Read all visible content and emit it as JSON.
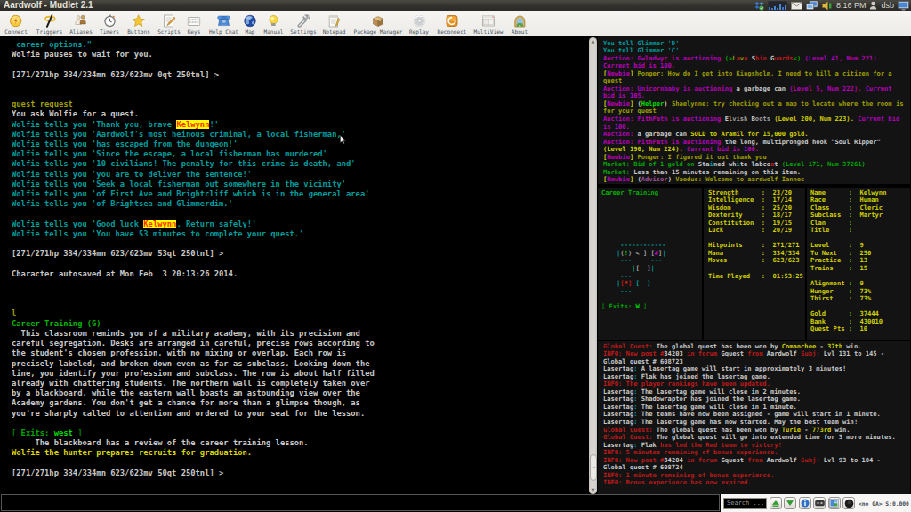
{
  "window": {
    "title": "Aardwolf - Mudlet 2.1"
  },
  "tray": {
    "time": "8:16 PM",
    "user": "dsb",
    "icons": [
      "dropbox",
      "system-monitor",
      "mail",
      "network",
      "volume",
      "user",
      "display"
    ]
  },
  "toolbar": {
    "items": [
      {
        "id": "connect",
        "label": "Connect"
      },
      {
        "id": "triggers",
        "label": "Triggers"
      },
      {
        "id": "aliases",
        "label": "Aliases"
      },
      {
        "id": "timers",
        "label": "Timers"
      },
      {
        "id": "buttons",
        "label": "Buttons"
      },
      {
        "id": "scripts",
        "label": "Scripts"
      },
      {
        "id": "keys",
        "label": "Keys"
      },
      {
        "id": "helpchat",
        "label": "Help Chat"
      },
      {
        "id": "map",
        "label": "Map"
      },
      {
        "id": "manual",
        "label": "Manual"
      },
      {
        "id": "settings",
        "label": "Settings"
      },
      {
        "id": "notepad",
        "label": "Notepad"
      },
      {
        "id": "package",
        "label": "Package Manager"
      },
      {
        "id": "replay",
        "label": "Replay"
      },
      {
        "id": "reconnect",
        "label": "Reconnect"
      },
      {
        "id": "multiview",
        "label": "MultiView"
      },
      {
        "id": "about",
        "label": "About"
      }
    ]
  },
  "palette": {
    "w": "#c8c8c8",
    "c": "#009c9c",
    "o": "#9e9e00",
    "y": "#cfcf00",
    "Y": "#d8d800",
    "m": "#b800b8",
    "M": "#d400d4",
    "dm": "#9c4f9c",
    "r": "#bb1a1a",
    "R": "#e82222",
    "g": "#00a400",
    "G": "#00dc00",
    "dg": "#008000",
    "GT": "#00b400",
    "gr": "#9f9f9f",
    "hl": "#ff3000 on #ffff00"
  },
  "main_console": {
    "lines": [
      [
        [
          "c",
          " career options.\""
        ]
      ],
      "Wolfie pauses to wait for you.",
      "",
      "[271/271hp 334/334mn 623/623mv 0qt 250tnl] >",
      "",
      "",
      [
        [
          "o",
          "quest request"
        ]
      ],
      "You ask Wolfie for a quest.",
      [
        [
          "c",
          "Wolfie tells you 'Thank you, brave "
        ],
        [
          "hl",
          "Kelwynn"
        ],
        [
          "c",
          "!'"
        ]
      ],
      [
        [
          "c",
          "Wolfie tells you 'Aardwolf's most heinous criminal, a local fisherman,'"
        ]
      ],
      [
        [
          "c",
          "Wolfie tells you 'has escaped from the dungeon!'"
        ]
      ],
      [
        [
          "c",
          "Wolfie tells you 'Since the escape, a local fisherman has murdered'"
        ]
      ],
      [
        [
          "c",
          "Wolfie tells you '10 civilians! The penalty for this crime is death, and'"
        ]
      ],
      [
        [
          "c",
          "Wolfie tells you 'you are to deliver the sentence!'"
        ]
      ],
      [
        [
          "c",
          "Wolfie tells you 'Seek a local fisherman out somewhere in the vicinity'"
        ]
      ],
      [
        [
          "c",
          "Wolfie tells you 'of First Ave and Brightcliff which is in the general area'"
        ]
      ],
      [
        [
          "c",
          "Wolfie tells you 'of Brightsea and Glimmerdim.'"
        ]
      ],
      "",
      [
        [
          "c",
          "Wolfie tells you 'Good luck "
        ],
        [
          "hl",
          "Kelwynn"
        ],
        [
          "c",
          ". Return safely!'"
        ]
      ],
      [
        [
          "c",
          "Wolfie tells you 'You have 53 minutes to complete your quest.'"
        ]
      ],
      "",
      "[271/271hp 334/334mn 623/623mv 53qt 250tnl] >",
      "",
      "Character autosaved at Mon Feb  3 20:13:26 2014.",
      "",
      "",
      "",
      [
        [
          "o",
          "l"
        ]
      ],
      [
        [
          "GT",
          "Career Training (G)"
        ]
      ],
      "  This classroom reminds you of a military academy, with its precision and",
      "careful segregation. Desks are arranged in careful, precise rows according to",
      "the student's chosen profession, with no mixing or overlap. Each row is",
      "precisely labeled, and broken down even as far as subclass. Looking down the",
      "line, you identify your profession and subclass. The row is about half filled",
      "already with chattering students. The northern wall is completely taken over",
      "by a blackboard, while the eastern wall boasts an astounding view over the",
      "Academy gardens. You don't get a chance for more than a glimpse though, as",
      "you're sharply called to attention and ordered to your seat for the lesson.",
      "",
      [
        [
          "dg",
          "[ "
        ],
        [
          "g",
          "Exits: "
        ],
        [
          "G",
          "west"
        ],
        [
          "dg",
          " ]"
        ]
      ],
      "     The blackboard has a review of the career training lesson.",
      [
        [
          "Y",
          "Wolfie the hunter prepares recruits for graduation."
        ]
      ],
      "",
      "[271/271hp 334/334mn 623/623mv 50qt 250tnl] >"
    ]
  },
  "chat_window": {
    "lines": [
      [
        [
          "c",
          "You tell Glimmer 'D'"
        ]
      ],
      [
        [
          "c",
          "You tell Glimmer 'C'"
        ]
      ],
      [
        [
          "m",
          "Auction: Gwladwyr is auctioning "
        ],
        [
          "g",
          "(>"
        ],
        [
          "o",
          "L"
        ],
        [
          "r",
          "a"
        ],
        [
          "o",
          "v"
        ],
        [
          "r",
          "a"
        ],
        [
          "w",
          " "
        ],
        [
          "w",
          "S"
        ],
        [
          "r",
          "hin"
        ],
        [
          "w",
          " "
        ],
        [
          "w",
          "G"
        ],
        [
          "r",
          "uards"
        ],
        [
          "g",
          "<)"
        ],
        [
          "m",
          " (Level 41, Num 221)."
        ]
      ],
      [
        [
          "m",
          "Current bid is 100."
        ]
      ],
      [
        [
          "y",
          "["
        ],
        [
          "m",
          "Newbie"
        ],
        [
          "y",
          "] "
        ],
        [
          "o",
          "Ponger: How do I get into Kingsholm, I need to kill a citizen for a"
        ]
      ],
      [
        [
          "o",
          "quest"
        ]
      ],
      [
        [
          "m",
          "Auction: Unicornbaby is auctioning "
        ],
        [
          "w",
          "a garbage can"
        ],
        [
          "m",
          " (Level 5, Num 222). Current"
        ]
      ],
      [
        [
          "m",
          "bid is 105."
        ]
      ],
      [
        [
          "y",
          "["
        ],
        [
          "m",
          "Newbie"
        ],
        [
          "y",
          "] "
        ],
        [
          "w",
          "("
        ],
        [
          "G",
          "Helper"
        ],
        [
          "w",
          ") "
        ],
        [
          "o",
          "Shaelynne: try checking out a map to locate where the room is"
        ]
      ],
      [
        [
          "o",
          "for your quest"
        ]
      ],
      [
        [
          "m",
          "Auction: FithFath is auctioning "
        ],
        [
          "w",
          "E"
        ],
        [
          "gr",
          "lvish "
        ],
        [
          "w",
          "B"
        ],
        [
          "gr",
          "oots"
        ],
        [
          "y",
          " (Level 200, Num 223)."
        ],
        [
          "m",
          " Current bid"
        ]
      ],
      [
        [
          "m",
          "is 100."
        ]
      ],
      [
        [
          "m",
          "Auction: "
        ],
        [
          "w",
          "a garbage can "
        ],
        [
          "y",
          "SOLD to Aramil for 15,000 gold."
        ]
      ],
      [
        [
          "m",
          "Auction: FithFath is auctioning "
        ],
        [
          "w",
          "the long, multipronged hook \"Soul Ripper\""
        ]
      ],
      [
        [
          "y",
          "(Level 190, Num 224)."
        ],
        [
          "m",
          " Current bid is 100."
        ]
      ],
      [
        [
          "y",
          "["
        ],
        [
          "m",
          "Newbie"
        ],
        [
          "y",
          "] "
        ],
        [
          "o",
          "Ponger: I figured it out thank you"
        ]
      ],
      [
        [
          "g",
          "Market: Bid of 1 gold on "
        ],
        [
          "w",
          "Sta"
        ],
        [
          "c",
          "i"
        ],
        [
          "w",
          "ned wh"
        ],
        [
          "c",
          "i"
        ],
        [
          "w",
          "te labco"
        ],
        [
          "r",
          "a"
        ],
        [
          "w",
          "t"
        ],
        [
          "g",
          " (Level 171, Num 37261)"
        ]
      ],
      [
        [
          "g",
          "Market:"
        ],
        [
          "w",
          " Less than 15 minutes remaining on this item."
        ]
      ],
      [
        [
          "y",
          "["
        ],
        [
          "m",
          "Newbie"
        ],
        [
          "y",
          "] "
        ],
        [
          "w",
          "("
        ],
        [
          "dm",
          "Advisor"
        ],
        [
          "w",
          ") "
        ],
        [
          "o",
          "Vaedus: Welcome to aardwolf Iannes"
        ]
      ]
    ]
  },
  "stats_window": {
    "col1": {
      "lines": [
        [
          [
            "GT",
            "Career Training"
          ]
        ],
        "",
        "",
        "",
        "",
        "",
        "",
        [
          [
            "c",
            "     ------------"
          ]
        ],
        [
          [
            "c",
            "    |"
          ],
          [
            "gr",
            "("
          ],
          [
            "G",
            "!"
          ],
          [
            "gr",
            ") < ] ["
          ],
          [
            "M",
            "#"
          ],
          [
            "gr",
            "]"
          ],
          [
            "c",
            "|"
          ]
        ],
        [
          [
            "c",
            "     ---     ---"
          ]
        ],
        [
          [
            "c",
            "        |"
          ],
          [
            "gr",
            "[  ]"
          ],
          [
            "c",
            "|"
          ]
        ],
        [
          [
            "c",
            "     ---"
          ]
        ],
        [
          [
            "c",
            "    |"
          ],
          [
            "r",
            "["
          ],
          [
            "R",
            "*"
          ],
          [
            "r",
            "]"
          ],
          [
            "c",
            " [  ]"
          ]
        ],
        [
          [
            "c",
            "     ---"
          ]
        ],
        "",
        [
          [
            "dg",
            "["
          ],
          [
            "g",
            " Exits: "
          ],
          [
            "G",
            "W"
          ],
          [
            "dg",
            " ]"
          ]
        ]
      ]
    },
    "col2": {
      "lines": [
        "Strength      :  23/20",
        "Intelligence  :  17/14",
        "Wisdom        :  25/20",
        "Dexterity     :  18/17",
        "Constitution  :  19/15",
        "Luck          :  20/19",
        "",
        "Hitpoints     :  271/271",
        "Mana          :  334/334",
        "Moves         :  623/623",
        "",
        "Time Played   :  01:53:25"
      ]
    },
    "col3": {
      "lines": [
        "Name      :  Kelwynn",
        "Race      :  Human",
        "Class     :  Cleric",
        "Subclass  :  Martyr",
        "Clan      :",
        "Title     :",
        "",
        "Level     :  9",
        "To Next   :  250",
        "Practice  :  13",
        "Trains    :  15",
        "",
        "Alignment :  0",
        "Hunger    :  73%",
        "Thirst    :  73%",
        "",
        "Gold      :  37444",
        "Bank      :  430010",
        "Quest Pts :  10"
      ]
    }
  },
  "quest_window": {
    "lines": [
      [
        [
          "r",
          "Global Quest: "
        ],
        [
          "w",
          "The global quest has been won by "
        ],
        [
          "y",
          "Comanchee"
        ],
        [
          "w",
          " - "
        ],
        [
          "y",
          "37th"
        ],
        [
          "w",
          " win."
        ]
      ],
      [
        [
          "r",
          "INFO: New post #"
        ],
        [
          "w",
          "34203"
        ],
        [
          "r",
          " in forum "
        ],
        [
          "w",
          "Gquest"
        ],
        [
          "r",
          " from "
        ],
        [
          "w",
          "Aardwolf"
        ],
        [
          "r",
          " Subj:"
        ],
        [
          "w",
          " Lvl 131 to 145 -"
        ]
      ],
      [
        [
          "w",
          "Global quest # 608723"
        ]
      ],
      [
        [
          "w",
          "Lasertag"
        ],
        [
          "c",
          ":"
        ],
        [
          "w",
          " A lasertag game will start in approximately 3 minutes!"
        ]
      ],
      [
        [
          "w",
          "Lasertag"
        ],
        [
          "c",
          ":"
        ],
        [
          "w",
          " Flak has joined the lasertag game."
        ]
      ],
      [
        [
          "r",
          "INFO: The player rankings have been updated."
        ]
      ],
      [
        [
          "w",
          "Lasertag"
        ],
        [
          "c",
          ":"
        ],
        [
          "w",
          " The lasertag game will close in 2 minutes."
        ]
      ],
      [
        [
          "w",
          "Lasertag"
        ],
        [
          "c",
          ":"
        ],
        [
          "w",
          " Shadowraptor has joined the lasertag game."
        ]
      ],
      [
        [
          "w",
          "Lasertag"
        ],
        [
          "c",
          ":"
        ],
        [
          "w",
          " The lasertag game will close in 1 minute."
        ]
      ],
      [
        [
          "w",
          "Lasertag"
        ],
        [
          "c",
          ":"
        ],
        [
          "w",
          " The teams have now been assigned - game will start in 1 minute."
        ]
      ],
      [
        [
          "w",
          "Lasertag"
        ],
        [
          "c",
          ":"
        ],
        [
          "w",
          " The lasertag game has now started. May the best team win!"
        ]
      ],
      [
        [
          "r",
          "Global Quest: "
        ],
        [
          "w",
          "The global quest has been won by "
        ],
        [
          "y",
          "Turie"
        ],
        [
          "w",
          " - "
        ],
        [
          "y",
          "773rd"
        ],
        [
          "w",
          " win."
        ]
      ],
      [
        [
          "r",
          "Global Quest: "
        ],
        [
          "w",
          "The global quest will go into extended time for 3 more minutes."
        ]
      ],
      [
        [
          "w",
          "Lasertag"
        ],
        [
          "c",
          ":"
        ],
        [
          "w",
          " Flak "
        ],
        [
          "r",
          "has led the Red team to victory!"
        ]
      ],
      [
        [
          "r",
          "INFO: 5 minutes remaining of bonus experience."
        ]
      ],
      [
        [
          "r",
          "INFO: New post #"
        ],
        [
          "w",
          "34204"
        ],
        [
          "r",
          " in forum "
        ],
        [
          "w",
          "Gquest"
        ],
        [
          "r",
          " from "
        ],
        [
          "w",
          "Aardwolf"
        ],
        [
          "r",
          " Subj:"
        ],
        [
          "w",
          " Lvl 93 to 104 -"
        ]
      ],
      [
        [
          "w",
          "Global quest # 608724"
        ]
      ],
      [
        [
          "r",
          "INFO: 1 minute remaining of bonus experience."
        ]
      ],
      [
        [
          "r",
          "INFO: Bonus experience has now expired."
        ]
      ]
    ]
  },
  "status_bar": {
    "search_placeholder": "Search ...",
    "ga_text": "<no GA> S:0.000",
    "buttons": [
      "search-up",
      "search-down",
      "info",
      "keyboard",
      "multi-window",
      "mute"
    ]
  }
}
